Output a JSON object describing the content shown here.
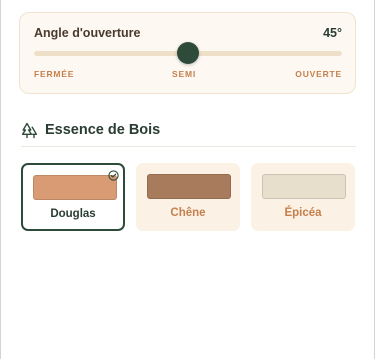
{
  "angle": {
    "label": "Angle d'ouverture",
    "value_text": "45°",
    "value_fraction": 0.5,
    "scale": {
      "min": "FERMÉE",
      "mid": "SEMI",
      "max": "OUVERTE"
    }
  },
  "wood_section": {
    "title": "Essence de Bois",
    "icon": "trees-icon",
    "options": [
      {
        "name": "Douglas",
        "color": "#d89b73",
        "selected": true
      },
      {
        "name": "Chêne",
        "color": "#a87b5c",
        "selected": false
      },
      {
        "name": "Épicéa",
        "color": "#e8decc",
        "selected": false
      }
    ]
  },
  "colors": {
    "accent": "#2e4b3a",
    "label_orange": "#c5804e",
    "card_bg": "#fbf1e4"
  }
}
